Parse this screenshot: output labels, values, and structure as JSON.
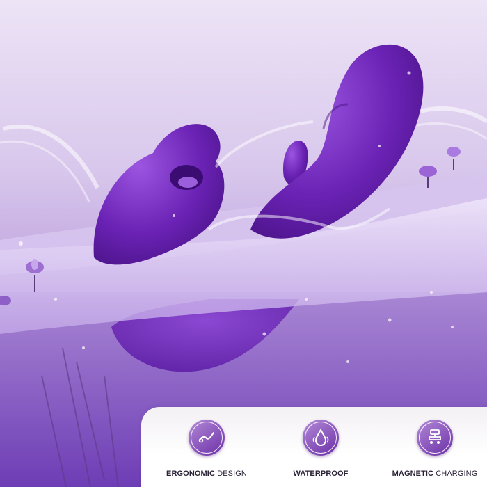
{
  "features": [
    {
      "bold": "ERGONOMIC",
      "rest": " DESIGN",
      "icon": "curved-product-icon"
    },
    {
      "bold": "WATERPROOF",
      "rest": "",
      "icon": "water-drop-icon"
    },
    {
      "bold": "MAGNETIC",
      "rest": " CHARGING",
      "icon": "magnetic-charger-icon"
    }
  ],
  "colors": {
    "product_purple": "#6a22b4",
    "water_lavender": "#b79ad8",
    "icon_gradient_start": "#b48ad8",
    "icon_gradient_end": "#6a2fa6"
  }
}
